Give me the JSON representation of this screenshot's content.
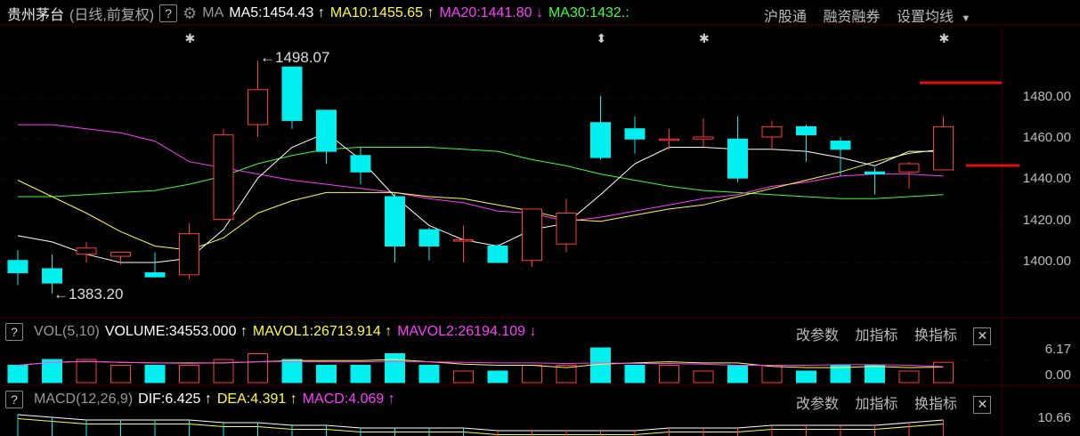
{
  "header": {
    "stock_name": "贵州茅台",
    "period": "(日线,前复权)",
    "help_icon": "?",
    "settings_icon": "gear-icon",
    "ma_label": "MA",
    "ma5": "MA5:1454.43",
    "ma10": "MA10:1455.65",
    "ma20": "MA20:1441.80",
    "ma30": "MA30:1432.:",
    "link1": "沪股通",
    "link2": "融资融券",
    "settings_menu": "设置均线",
    "up_arrow": "↑",
    "down_arrow": "↓"
  },
  "colors": {
    "up": "#ff3b3b",
    "down": "#00f0f0",
    "ma5": "#ffffff",
    "ma10": "#ffff3c",
    "ma20": "#ff3cff",
    "ma30": "#3cff3c",
    "bg": "#000000",
    "grid": "#3a0000"
  },
  "price_axis": {
    "ticks": [
      "1480.00",
      "1460.00",
      "1440.00",
      "1420.00",
      "1400.00"
    ]
  },
  "annotations": {
    "high": "1498.07",
    "low": "1383.20"
  },
  "volume_panel": {
    "help_icon": "?",
    "label": "VOL(5,10)",
    "volume": "VOLUME:34553.000",
    "mavol1": "MAVOL1:26713.914",
    "mavol2": "MAVOL2:26194.109",
    "tools": [
      "改参数",
      "加指标",
      "换指标"
    ],
    "close": "✕",
    "ticks": [
      "6.17",
      "0.00"
    ]
  },
  "macd_panel": {
    "help_icon": "?",
    "label": "MACD(12,26,9)",
    "dif": "DIF:6.425",
    "dea": "DEA:4.391",
    "macd": "MACD:4.069",
    "tools": [
      "改参数",
      "加指标",
      "换指标"
    ],
    "close": "✕",
    "ticks": [
      "10.66"
    ]
  },
  "chart_data": {
    "type": "candlestick",
    "ylim": [
      1375,
      1505
    ],
    "ohlc": [
      [
        1401,
        1406,
        1389,
        1395
      ],
      [
        1397,
        1404,
        1385,
        1390
      ],
      [
        1404,
        1410,
        1400,
        1407
      ],
      [
        1403,
        1405,
        1399,
        1405
      ],
      [
        1395,
        1405,
        1393,
        1393
      ],
      [
        1394,
        1419,
        1392,
        1414
      ],
      [
        1421,
        1465,
        1421,
        1462
      ],
      [
        1467,
        1498,
        1461,
        1484
      ],
      [
        1495,
        1495,
        1465,
        1469
      ],
      [
        1474,
        1474,
        1448,
        1454
      ],
      [
        1452,
        1456,
        1438,
        1444
      ],
      [
        1432,
        1434,
        1400,
        1408
      ],
      [
        1416,
        1417,
        1401,
        1408
      ],
      [
        1411,
        1418,
        1400,
        1411
      ],
      [
        1408,
        1409,
        1400,
        1400
      ],
      [
        1401,
        1425,
        1398,
        1426
      ],
      [
        1409,
        1431,
        1405,
        1424
      ],
      [
        1468,
        1481,
        1450,
        1451
      ],
      [
        1465,
        1471,
        1453,
        1460
      ],
      [
        1460,
        1465,
        1455,
        1460
      ],
      [
        1460,
        1470,
        1456,
        1461
      ],
      [
        1460,
        1471,
        1439,
        1441
      ],
      [
        1461,
        1469,
        1455,
        1466
      ],
      [
        1466,
        1467,
        1449,
        1462
      ],
      [
        1459,
        1461,
        1442,
        1455
      ],
      [
        1444,
        1446,
        1433,
        1443
      ],
      [
        1444,
        1449,
        1436,
        1448
      ],
      [
        1445,
        1471,
        1445,
        1466
      ]
    ],
    "ma5": [
      1413,
      1410,
      1404,
      1400,
      1400,
      1402,
      1416,
      1441,
      1456,
      1463,
      1450,
      1432,
      1418,
      1411,
      1408,
      1416,
      1419,
      1433,
      1448,
      1456,
      1456,
      1455,
      1455,
      1454,
      1451,
      1447,
      1454,
      1454
    ],
    "ma10": [
      1440,
      1432,
      1424,
      1415,
      1408,
      1406,
      1412,
      1424,
      1430,
      1434,
      1434,
      1434,
      1432,
      1431,
      1428,
      1425,
      1421,
      1420,
      1423,
      1426,
      1428,
      1432,
      1436,
      1440,
      1444,
      1449,
      1453,
      1455
    ],
    "ma20": [
      1467,
      1467,
      1465,
      1463,
      1459,
      1449,
      1446,
      1443,
      1440,
      1438,
      1436,
      1434,
      1431,
      1429,
      1425,
      1424,
      1420,
      1422,
      1425,
      1428,
      1431,
      1433,
      1437,
      1439,
      1442,
      1443,
      1443,
      1442
    ],
    "ma30": [
      1432,
      1432,
      1433,
      1434,
      1435,
      1438,
      1442,
      1448,
      1452,
      1455,
      1456,
      1456,
      1456,
      1455,
      1454,
      1450,
      1447,
      1443,
      1440,
      1437,
      1435,
      1434,
      1433,
      1432,
      1431,
      1431,
      1432,
      1433
    ],
    "volume": [
      3,
      4,
      4,
      3,
      3,
      3,
      4,
      5,
      4,
      3,
      3,
      5,
      3,
      2,
      2,
      3,
      3,
      6,
      3,
      3,
      2,
      3,
      3,
      2,
      3,
      3,
      2,
      3.5
    ],
    "macd_dif": [
      8,
      7,
      6,
      6,
      6,
      6,
      5,
      5,
      4,
      4,
      3,
      3,
      3,
      3,
      2,
      2,
      2,
      2,
      2,
      3,
      3,
      3,
      4,
      4,
      4,
      4,
      5,
      6
    ]
  }
}
